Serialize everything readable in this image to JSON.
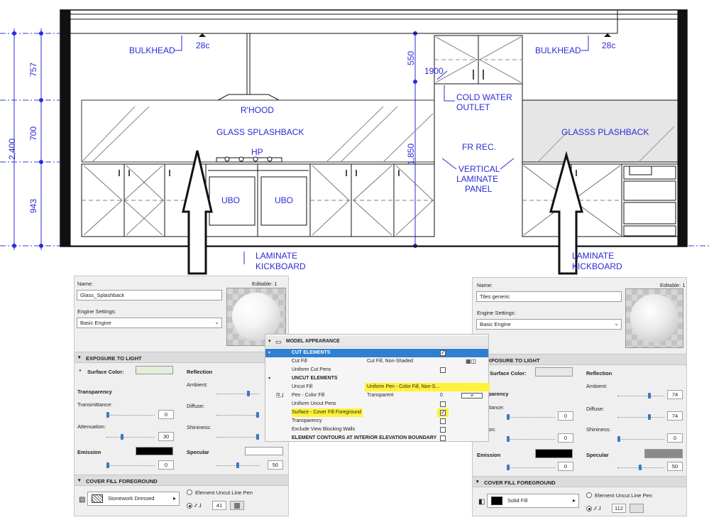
{
  "drawing": {
    "labels": {
      "bulkhead_left": "BULKHEAD",
      "bulkhead_left_tag": "28c",
      "bulkhead_right": "BULKHEAD",
      "bulkhead_right_tag": "28c",
      "rhood": "R'HOOD",
      "glass_splashback": "GLASS SPLASHBACK",
      "hp": "HP",
      "ubo_1": "UBO",
      "ubo_2": "UBO",
      "cold_water_outlet_1": "COLD WATER",
      "cold_water_outlet_2": "OUTLET",
      "fr_rec": "FR REC.",
      "vertical_panel_1": "VERTICAL",
      "vertical_panel_2": "LAMINATE",
      "vertical_panel_3": "PANEL",
      "glasss_plashback": "GLASSS PLASHBACK",
      "laminate_kick_left_1": "LAMINATE",
      "laminate_kick_left_2": "KICKBOARD",
      "laminate_kick_right_1": "LAMINATE",
      "laminate_kick_right_2": "KICKBOARD"
    },
    "dimensions": {
      "overall": "2,400",
      "upper": "757",
      "middle": "700",
      "lower": "943",
      "dim_550": "550",
      "dim_1850": "1,850",
      "dim_1900": "1900"
    }
  },
  "left_panel": {
    "name_label": "Name:",
    "editable": "Editable: 1",
    "name_value": "Glass_Splashback",
    "engine_label": "Engine Settings:",
    "engine_value": "Basic Engine",
    "section_exposure": "EXPOSURE TO LIGHT",
    "surface_color": "Surface Color:",
    "reflection": "Reflection",
    "ambient": "Ambient:",
    "transparency": "Transparency",
    "transmittance": "Transmittance:",
    "transmittance_value": "0",
    "diffuse": "Diffuse:",
    "attenuation": "Attenuation:",
    "attenuation_value": "30",
    "shininess": "Shininess:",
    "emission": "Emission",
    "emission_value": "0",
    "specular": "Specular",
    "specular_value": "50",
    "section_cover": "COVER FILL FOREGROUND",
    "fill_name": "Stonework Dressed",
    "uncut_pen": "Element Uncut Line Pen",
    "pen_value": "41",
    "surface_color_hex": "#e3eedb"
  },
  "right_panel": {
    "name_label": "Name:",
    "editable": "Editable: 1",
    "name_value": "Tiles generic",
    "engine_label": "Engine Settings:",
    "engine_value": "Basic Engine",
    "section_exposure": "EXPOSURE TO LIGHT",
    "surface_color": "Surface Color:",
    "reflection": "Reflection",
    "ambient": "Ambient:",
    "ambient_value": "74",
    "transparency": "ransparency",
    "transmittance": "nsmittance:",
    "transmittance_value": "0",
    "diffuse": "Diffuse:",
    "diffuse_value": "74",
    "attenuation": "nuation:",
    "attenuation_value": "0",
    "shininess": "Shininess:",
    "shininess_value": "0",
    "emission": "Emission",
    "emission_value": "0",
    "specular": "Specular",
    "specular_value": "50",
    "section_cover": "COVER FILL FOREGROUND",
    "fill_name": "Solid Fill",
    "uncut_pen": "Element Uncut Line Pen",
    "pen_value": "112",
    "surface_color_hex": "#e8e8e8"
  },
  "model_appearance": {
    "title": "MODEL APPEARANCE",
    "cut_elements": "CUT ELEMENTS",
    "cut_fill": "Cut Fill",
    "cut_fill_value": "Cut Fill, Non-Shaded",
    "uniform_cut_pens": "Uniform Cut Pens",
    "uncut_elements": "UNCUT ELEMENTS",
    "uncut_fill": "Uncut Fill",
    "uncut_fill_value": "Uniform Pen - Color Fill, Non-S...",
    "pen_color_fill": "Pen - Color Fill",
    "pen_color_fill_value": "Transparent",
    "pen_color_fill_num": "0",
    "uniform_uncut_pens": "Uniform Uncut Pens",
    "surface_cover": "Surface - Cover Fill Foreground",
    "transparency": "Transparency",
    "exclude_view": "Exclude View Blocking Walls",
    "element_contours": "ELEMENT CONTOURS AT INTERIOR ELEVATION BOUNDARY"
  }
}
